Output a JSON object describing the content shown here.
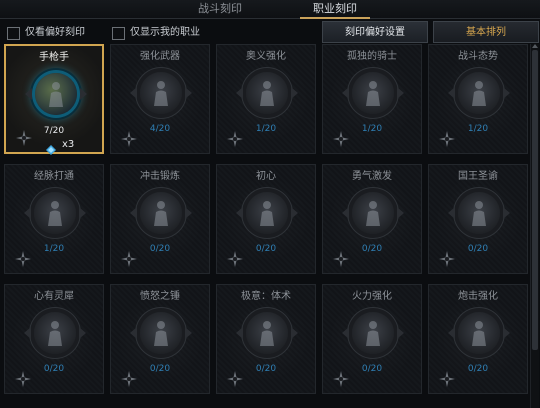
{
  "tabs": [
    {
      "label": "战斗刻印"
    },
    {
      "label": "职业刻印"
    }
  ],
  "filters": {
    "favorites_only": "仅看偏好刻印",
    "my_class_only": "仅显示我的职业"
  },
  "buttons": {
    "preference": "刻印偏好设置",
    "sort": "基本排列"
  },
  "colors": {
    "accent_gold": "#d1a550",
    "level_blue": "#2f7fb4"
  },
  "cards": [
    {
      "name": "手枪手",
      "level": "7/20",
      "gems": "x3",
      "selected": true
    },
    {
      "name": "强化武器",
      "level": "4/20"
    },
    {
      "name": "奥义强化",
      "level": "1/20"
    },
    {
      "name": "孤独的骑士",
      "level": "1/20"
    },
    {
      "name": "战斗态势",
      "level": "1/20"
    },
    {
      "name": "经脉打通",
      "level": "1/20"
    },
    {
      "name": "冲击锻炼",
      "level": "0/20"
    },
    {
      "name": "初心",
      "level": "0/20"
    },
    {
      "name": "勇气激发",
      "level": "0/20"
    },
    {
      "name": "国王圣谕",
      "level": "0/20"
    },
    {
      "name": "心有灵犀",
      "level": "0/20"
    },
    {
      "name": "愤怒之锤",
      "level": "0/20"
    },
    {
      "name": "极意：体术",
      "level": "0/20"
    },
    {
      "name": "火力强化",
      "level": "0/20"
    },
    {
      "name": "炮击强化",
      "level": "0/20"
    }
  ],
  "icons": {
    "compass": "compass-icon",
    "gem": "gem-icon"
  }
}
